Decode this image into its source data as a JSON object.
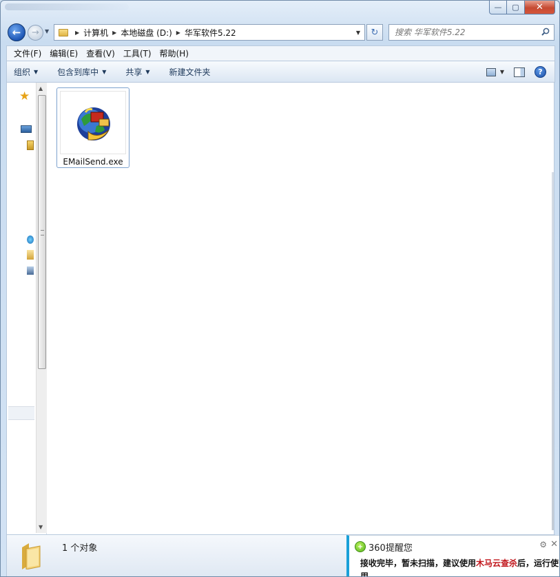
{
  "addressbar": {
    "crumbs": [
      "计算机",
      "本地磁盘 (D:)",
      "华军软件5.22"
    ]
  },
  "search": {
    "placeholder": "搜索 华军软件5.22"
  },
  "menubar": {
    "items": [
      "文件(F)",
      "编辑(E)",
      "查看(V)",
      "工具(T)",
      "帮助(H)"
    ]
  },
  "toolbar": {
    "organize": "组织",
    "include_library": "包含到库中",
    "share": "共享",
    "new_folder": "新建文件夹"
  },
  "files": [
    {
      "name": "EMailSend.exe",
      "icon": "email-send-app-icon"
    }
  ],
  "statusbar": {
    "text": "1 个对象"
  },
  "popup": {
    "title": "360提醒您",
    "message_prefix": "接收完毕，暂未扫描，建议使用",
    "message_highlight": "木马云查杀",
    "message_suffix": "后，运行使用。",
    "highlight_color": "#c0141a"
  },
  "colors": {
    "popup_accent": "#1aa0d8",
    "close_button": "#c64a32"
  }
}
